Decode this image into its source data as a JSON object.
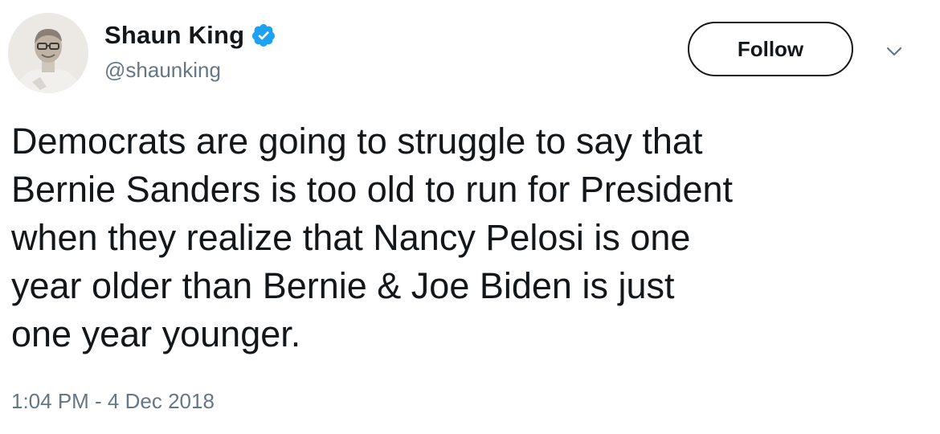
{
  "tweet": {
    "author": {
      "display_name": "Shaun King",
      "handle": "@shaunking",
      "verified": true
    },
    "follow_label": "Follow",
    "text": "Democrats are going to struggle to say that\nBernie Sanders is too old to run for President\nwhen they realize that Nancy Pelosi is one\nyear older than Bernie & Joe Biden is just\none year younger.",
    "timestamp": "1:04 PM - 4 Dec 2018"
  },
  "icons": {
    "verified": "verified-badge-icon",
    "menu": "chevron-down-icon",
    "avatar": "profile-photo"
  },
  "colors": {
    "text": "#14171a",
    "secondary": "#657786",
    "verified_blue": "#1da1f2",
    "background": "#ffffff"
  }
}
